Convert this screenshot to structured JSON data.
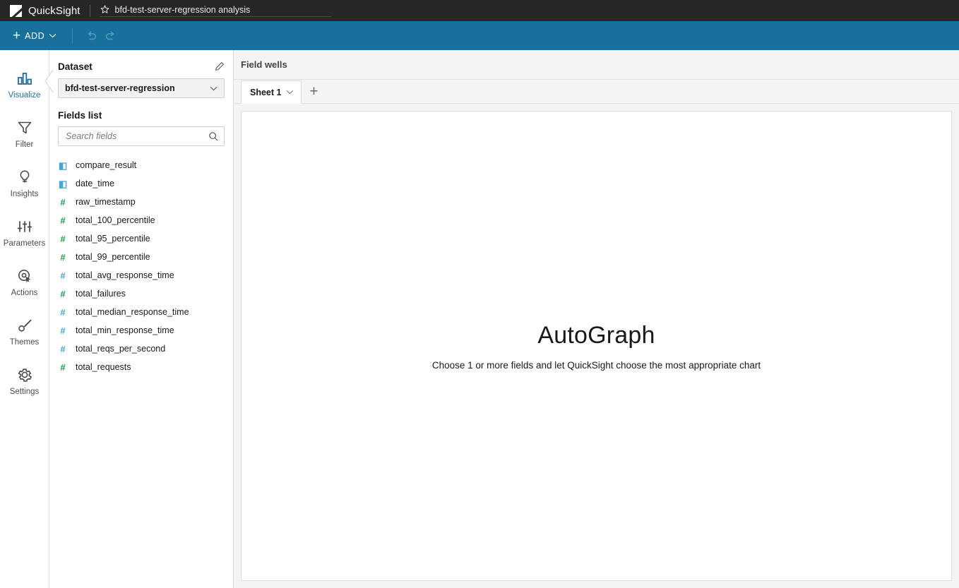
{
  "header": {
    "logo_icon": "quicksight-logo-icon",
    "product_name": "QuickSight",
    "favorite_icon": "star-icon",
    "analysis_title": "bfd-test-server-regression analysis",
    "background_color": "#262626"
  },
  "toolbar": {
    "add_label": "ADD",
    "add_plus_glyph": "+",
    "add_chevron_icon": "chevron-down-icon",
    "undo_icon": "undo-icon",
    "redo_icon": "redo-icon",
    "background_color": "#17709d"
  },
  "nav_rail": {
    "items": [
      {
        "label": "Visualize",
        "icon": "bar-chart-icon",
        "active": true
      },
      {
        "label": "Filter",
        "icon": "funnel-icon",
        "active": false
      },
      {
        "label": "Insights",
        "icon": "lightbulb-icon",
        "active": false
      },
      {
        "label": "Parameters",
        "icon": "sliders-icon",
        "active": false
      },
      {
        "label": "Actions",
        "icon": "cursor-target-icon",
        "active": false
      },
      {
        "label": "Themes",
        "icon": "paintbrush-icon",
        "active": false
      },
      {
        "label": "Settings",
        "icon": "gear-icon",
        "active": false
      }
    ],
    "active_color": "#1f6f9c",
    "inactive_color": "#4b4b4b"
  },
  "fields_panel": {
    "collapse_icon": "chevron-left-icon",
    "dataset_label": "Dataset",
    "edit_icon": "pencil-icon",
    "dataset_selected": "bfd-test-server-regression",
    "dataset_chevron_icon": "chevron-down-icon",
    "fields_list_label": "Fields list",
    "search_placeholder": "Search fields",
    "search_value": "",
    "search_icon": "search-icon",
    "fields": [
      {
        "name": "compare_result",
        "type": "string",
        "glyph": "◧",
        "color": "#41a7d4"
      },
      {
        "name": "date_time",
        "type": "string",
        "glyph": "◧",
        "color": "#41a7d4"
      },
      {
        "name": "raw_timestamp",
        "type": "integer",
        "glyph": "#",
        "color": "#1d9d4e"
      },
      {
        "name": "total_100_percentile",
        "type": "integer",
        "glyph": "#",
        "color": "#1d9d4e"
      },
      {
        "name": "total_95_percentile",
        "type": "integer",
        "glyph": "#",
        "color": "#1d9d4e"
      },
      {
        "name": "total_99_percentile",
        "type": "integer",
        "glyph": "#",
        "color": "#1d9d4e"
      },
      {
        "name": "total_avg_response_time",
        "type": "decimal",
        "glyph": "#",
        "color": "#41a7d4"
      },
      {
        "name": "total_failures",
        "type": "integer",
        "glyph": "#",
        "color": "#1d9d4e"
      },
      {
        "name": "total_median_response_time",
        "type": "decimal",
        "glyph": "#",
        "color": "#41a7d4"
      },
      {
        "name": "total_min_response_time",
        "type": "decimal",
        "glyph": "#",
        "color": "#41a7d4"
      },
      {
        "name": "total_reqs_per_second",
        "type": "decimal",
        "glyph": "#",
        "color": "#41a7d4"
      },
      {
        "name": "total_requests",
        "type": "integer",
        "glyph": "#",
        "color": "#1d9d4e"
      }
    ]
  },
  "workspace": {
    "field_wells_label": "Field wells",
    "sheet_tab_label": "Sheet 1",
    "sheet_tab_chevron_icon": "chevron-down-icon",
    "add_sheet_glyph": "+",
    "autograph_title": "AutoGraph",
    "autograph_subtitle": "Choose 1 or more fields and let QuickSight choose the most appropriate chart"
  }
}
